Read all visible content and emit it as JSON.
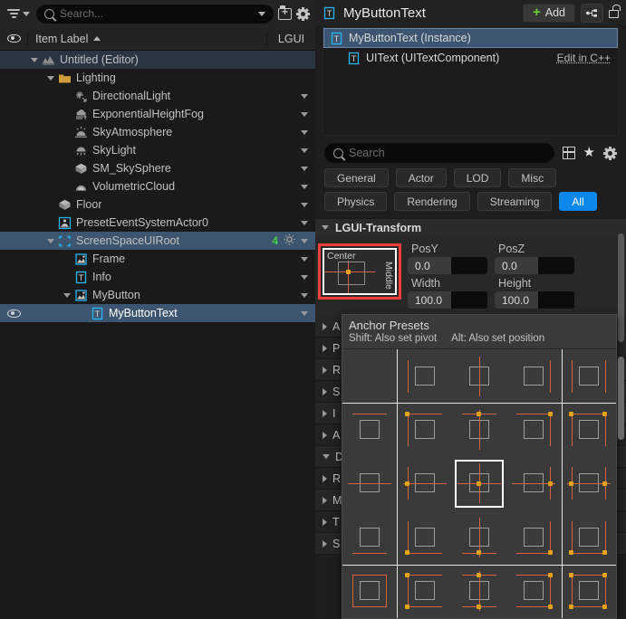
{
  "outliner": {
    "toolbar": {
      "filter_icon": "filter-icon",
      "search_placeholder": "Search...",
      "new_folder_icon": "new-folder-icon",
      "settings_icon": "gear-icon"
    },
    "header": {
      "visibility_icon": "eye-icon",
      "item_label": "Item Label",
      "sort_icon": "sort-ascending-icon",
      "lgui_column": "LGUI"
    },
    "rows": [
      {
        "label": "Untitled (Editor)",
        "icon": "world-icon",
        "indent": 1,
        "expanded": true,
        "chevron": true,
        "state": "sel-root",
        "eye": false,
        "dropdown": false,
        "badge": ""
      },
      {
        "label": "Lighting",
        "icon": "folder-icon",
        "indent": 2,
        "expanded": true,
        "chevron": true,
        "state": "",
        "eye": false,
        "dropdown": false,
        "badge": ""
      },
      {
        "label": "DirectionalLight",
        "icon": "directional-light-icon",
        "indent": 3,
        "expanded": false,
        "chevron": false,
        "state": "",
        "eye": false,
        "dropdown": true,
        "badge": ""
      },
      {
        "label": "ExponentialHeightFog",
        "icon": "fog-icon",
        "indent": 3,
        "expanded": false,
        "chevron": false,
        "state": "",
        "eye": false,
        "dropdown": true,
        "badge": ""
      },
      {
        "label": "SkyAtmosphere",
        "icon": "sky-atmosphere-icon",
        "indent": 3,
        "expanded": false,
        "chevron": false,
        "state": "",
        "eye": false,
        "dropdown": true,
        "badge": ""
      },
      {
        "label": "SkyLight",
        "icon": "sky-light-icon",
        "indent": 3,
        "expanded": false,
        "chevron": false,
        "state": "",
        "eye": false,
        "dropdown": true,
        "badge": ""
      },
      {
        "label": "SM_SkySphere",
        "icon": "static-mesh-icon",
        "indent": 3,
        "expanded": false,
        "chevron": false,
        "state": "",
        "eye": false,
        "dropdown": true,
        "badge": ""
      },
      {
        "label": "VolumetricCloud",
        "icon": "volumetric-cloud-icon",
        "indent": 3,
        "expanded": false,
        "chevron": false,
        "state": "",
        "eye": false,
        "dropdown": true,
        "badge": ""
      },
      {
        "label": "Floor",
        "icon": "static-mesh-icon",
        "indent": 2,
        "expanded": false,
        "chevron": false,
        "state": "",
        "eye": false,
        "dropdown": true,
        "badge": ""
      },
      {
        "label": "PresetEventSystemActor0",
        "icon": "event-system-icon",
        "indent": 2,
        "expanded": false,
        "chevron": false,
        "state": "",
        "eye": false,
        "dropdown": true,
        "badge": ""
      },
      {
        "label": "ScreenSpaceUIRoot",
        "icon": "ui-root-icon",
        "indent": 2,
        "expanded": true,
        "chevron": true,
        "state": "sel-mid",
        "eye": false,
        "dropdown": true,
        "badge": "4"
      },
      {
        "label": "Frame",
        "icon": "ui-sprite-icon",
        "indent": 3,
        "expanded": false,
        "chevron": false,
        "state": "",
        "eye": false,
        "dropdown": true,
        "badge": ""
      },
      {
        "label": "Info",
        "icon": "ui-text-icon",
        "indent": 3,
        "expanded": false,
        "chevron": false,
        "state": "",
        "eye": false,
        "dropdown": true,
        "badge": ""
      },
      {
        "label": "MyButton",
        "icon": "ui-sprite-icon",
        "indent": 3,
        "expanded": true,
        "chevron": true,
        "state": "",
        "eye": false,
        "dropdown": true,
        "badge": ""
      },
      {
        "label": "MyButtonText",
        "icon": "ui-text-icon",
        "indent": 4,
        "expanded": false,
        "chevron": false,
        "state": "sel",
        "eye": true,
        "dropdown": true,
        "badge": ""
      }
    ]
  },
  "details": {
    "title": "MyButtonText",
    "title_icon": "ui-text-icon",
    "add_label": "Add",
    "add_icon": "plus-icon",
    "components_icon": "component-graph-icon",
    "lock_icon": "unlock-icon",
    "component_tree": [
      {
        "label": "MyButtonText (Instance)",
        "icon": "ui-text-icon",
        "selected": true,
        "sub": false,
        "action": ""
      },
      {
        "label": "UIText (UITextComponent)",
        "icon": "ui-text-icon",
        "selected": false,
        "sub": true,
        "action": "Edit in C++"
      }
    ],
    "search_placeholder": "Search",
    "search_icon": "search-icon",
    "grid_icon": "grid-view-icon",
    "favorite_icon": "star-icon",
    "settings_icon": "gear-icon",
    "categories_row1": [
      {
        "label": "General",
        "active": false
      },
      {
        "label": "Actor",
        "active": false
      },
      {
        "label": "LOD",
        "active": false
      },
      {
        "label": "Misc",
        "active": false
      }
    ],
    "categories_row2": [
      {
        "label": "Physics",
        "active": false
      },
      {
        "label": "Rendering",
        "active": false
      },
      {
        "label": "Streaming",
        "active": false
      },
      {
        "label": "All",
        "active": true
      }
    ],
    "section_title": "LGUI-Transform",
    "anchor_widget": {
      "horizontal_label": "Center",
      "vertical_label": "Middle",
      "highlight_color": "#f0403c"
    },
    "transform_fields": [
      {
        "label": "PosY",
        "value": "0.0"
      },
      {
        "label": "PosZ",
        "value": "0.0"
      },
      {
        "label": "Width",
        "value": "100.0"
      },
      {
        "label": "Height",
        "value": "100.0"
      }
    ],
    "hidden_property_rows": [
      {
        "label": "A",
        "expanded": false
      },
      {
        "label": "P",
        "expanded": false
      },
      {
        "label": "R",
        "expanded": false
      },
      {
        "label": "S",
        "expanded": false
      },
      {
        "label": "I",
        "expanded": false
      },
      {
        "label": "A",
        "expanded": false
      },
      {
        "label": "D",
        "expanded": true
      },
      {
        "label": "R",
        "expanded": false
      },
      {
        "label": "M",
        "expanded": false
      },
      {
        "label": "T",
        "expanded": false
      },
      {
        "label": "S",
        "expanded": false
      }
    ]
  },
  "anchor_presets_popup": {
    "title": "Anchor Presets",
    "hint_shift": "Shift: Also set pivot",
    "hint_alt": "Alt: Also set position",
    "selected_index": 12,
    "anchor_color": "#d9633f",
    "point_color": "#e8a317",
    "cells": [
      {
        "row": 0,
        "col": 0,
        "kind": "empty"
      },
      {
        "row": 0,
        "col": 1,
        "kind": "stretch-v",
        "points": []
      },
      {
        "row": 0,
        "col": 2,
        "kind": "stretch-v",
        "points": []
      },
      {
        "row": 0,
        "col": 3,
        "kind": "stretch-v",
        "points": []
      },
      {
        "row": 0,
        "col": 4,
        "kind": "stretch-v",
        "points": []
      },
      {
        "row": 1,
        "col": 0,
        "kind": "stretch-h",
        "points": []
      },
      {
        "row": 1,
        "col": 1,
        "kind": "top-left",
        "points": [
          "tl"
        ]
      },
      {
        "row": 1,
        "col": 2,
        "kind": "top-center",
        "points": [
          "tc"
        ]
      },
      {
        "row": 1,
        "col": 3,
        "kind": "top-right",
        "points": [
          "tr"
        ]
      },
      {
        "row": 1,
        "col": 4,
        "kind": "top-stretch",
        "points": [
          "tl",
          "tr"
        ]
      },
      {
        "row": 2,
        "col": 0,
        "kind": "middle-hline",
        "points": []
      },
      {
        "row": 2,
        "col": 1,
        "kind": "middle-left",
        "points": [
          "ml"
        ]
      },
      {
        "row": 2,
        "col": 2,
        "kind": "middle-center",
        "points": [
          "mc"
        ]
      },
      {
        "row": 2,
        "col": 3,
        "kind": "middle-right",
        "points": [
          "mr"
        ]
      },
      {
        "row": 2,
        "col": 4,
        "kind": "middle-stretch",
        "points": [
          "ml",
          "mr"
        ]
      },
      {
        "row": 3,
        "col": 0,
        "kind": "bottom-hline",
        "points": []
      },
      {
        "row": 3,
        "col": 1,
        "kind": "bottom-left",
        "points": [
          "bl"
        ]
      },
      {
        "row": 3,
        "col": 2,
        "kind": "bottom-center",
        "points": [
          "bc"
        ]
      },
      {
        "row": 3,
        "col": 3,
        "kind": "bottom-right",
        "points": [
          "br"
        ]
      },
      {
        "row": 3,
        "col": 4,
        "kind": "bottom-stretch",
        "points": [
          "bl",
          "br"
        ]
      },
      {
        "row": 4,
        "col": 0,
        "kind": "full-box",
        "points": []
      },
      {
        "row": 4,
        "col": 1,
        "kind": "left-stretch",
        "points": [
          "tl",
          "bl"
        ]
      },
      {
        "row": 4,
        "col": 2,
        "kind": "center-stretch",
        "points": [
          "tc",
          "bc"
        ]
      },
      {
        "row": 4,
        "col": 3,
        "kind": "right-stretch",
        "points": [
          "tr",
          "br"
        ]
      },
      {
        "row": 4,
        "col": 4,
        "kind": "full-stretch",
        "points": [
          "tl",
          "tr",
          "bl",
          "br"
        ]
      }
    ]
  }
}
